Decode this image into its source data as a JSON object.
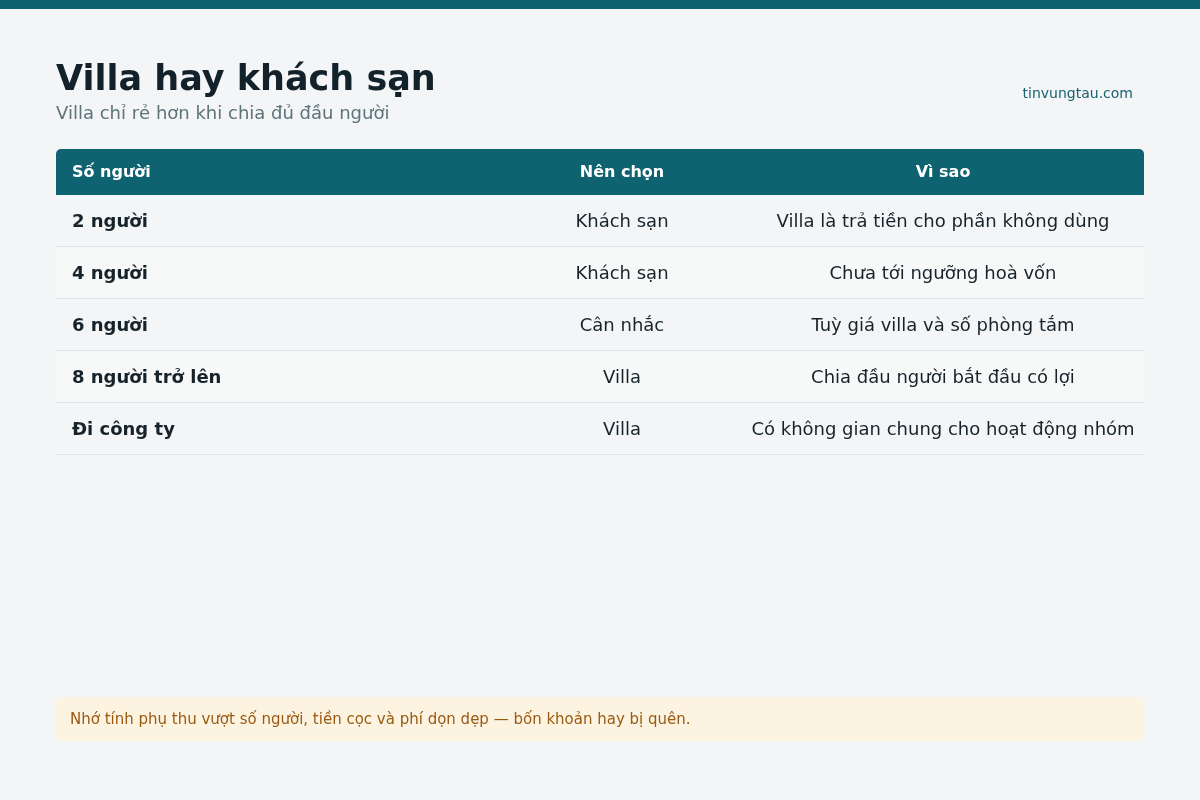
{
  "title": "Villa hay khách sạn",
  "subtitle": "Villa chỉ rẻ hơn khi chia đủ đầu người",
  "site": "tinvungtau.com",
  "table": {
    "columns": [
      "Số người",
      "Nên chọn",
      "Vì sao"
    ],
    "rows": [
      {
        "cells": [
          "2 người",
          "Khách sạn",
          "Villa là trả tiền cho phần không dùng"
        ]
      },
      {
        "cells": [
          "4 người",
          "Khách sạn",
          "Chưa tới ngưỡng hoà vốn"
        ]
      },
      {
        "cells": [
          "6 người",
          "Cân nhắc",
          "Tuỳ giá villa và số phòng tắm"
        ]
      },
      {
        "cells": [
          "8 người trở lên",
          "Villa",
          "Chia đầu người bắt đầu có lợi"
        ]
      },
      {
        "cells": [
          "Đi công ty",
          "Villa",
          "Có không gian chung cho hoạt động nhóm"
        ]
      }
    ]
  },
  "note": "Nhớ tính phụ thu vượt số người, tiền cọc và phí dọn dẹp — bốn khoản hay bị quên."
}
